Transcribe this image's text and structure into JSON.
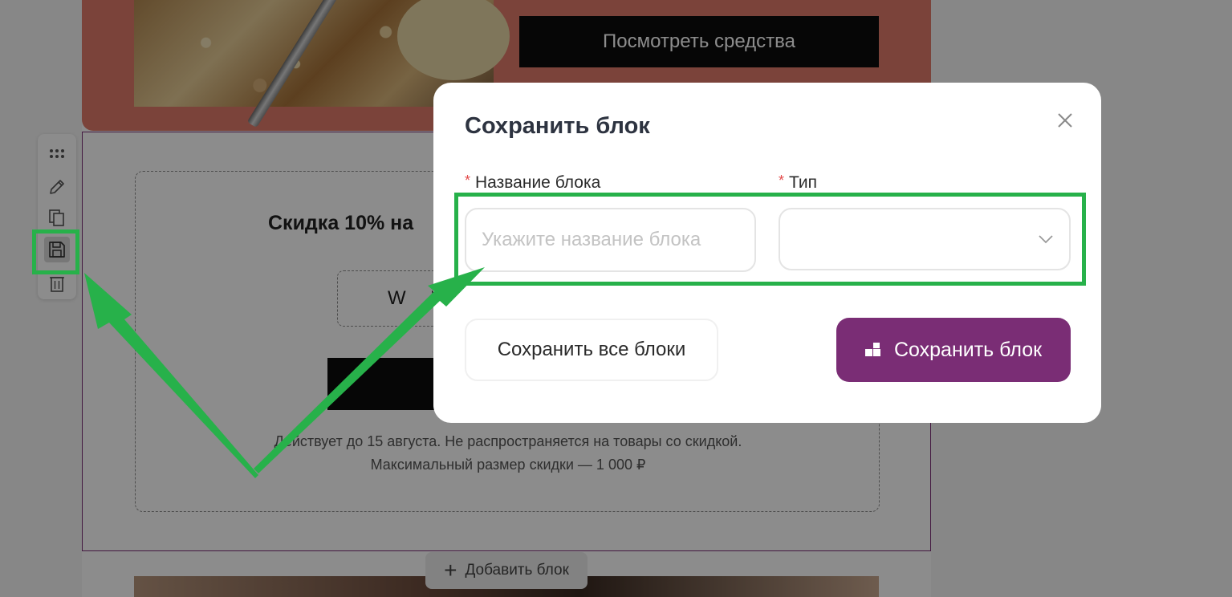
{
  "hero": {
    "button_label": "Посмотреть средства"
  },
  "coupon": {
    "title": "Скидка 10% на",
    "promo_code_partial": "W E",
    "note_line1": "Действует до 15 августа. Не распространяется на товары со скидкой.",
    "note_line2": "Максимальный размер скидки — 1 000 ₽"
  },
  "add_block": {
    "label": "Добавить блок"
  },
  "toolbar": {
    "items": [
      {
        "icon": "drag-handle-icon"
      },
      {
        "icon": "pencil-icon"
      },
      {
        "icon": "copy-icon"
      },
      {
        "icon": "floppy-disk-icon",
        "active": true
      },
      {
        "icon": "trash-icon"
      }
    ]
  },
  "modal": {
    "title": "Сохранить блок",
    "name_field": {
      "label": "Название блока",
      "required_mark": "*",
      "placeholder": "Укажите название блока",
      "value": ""
    },
    "type_field": {
      "label": "Тип",
      "required_mark": "*",
      "value": ""
    },
    "save_all_label": "Сохранить все блоки",
    "save_label": "Сохранить блок"
  },
  "colors": {
    "accent": "#7a2d75",
    "hero_background": "#e07a6a",
    "annotation": "#27b14a",
    "required": "#e34a4a"
  }
}
